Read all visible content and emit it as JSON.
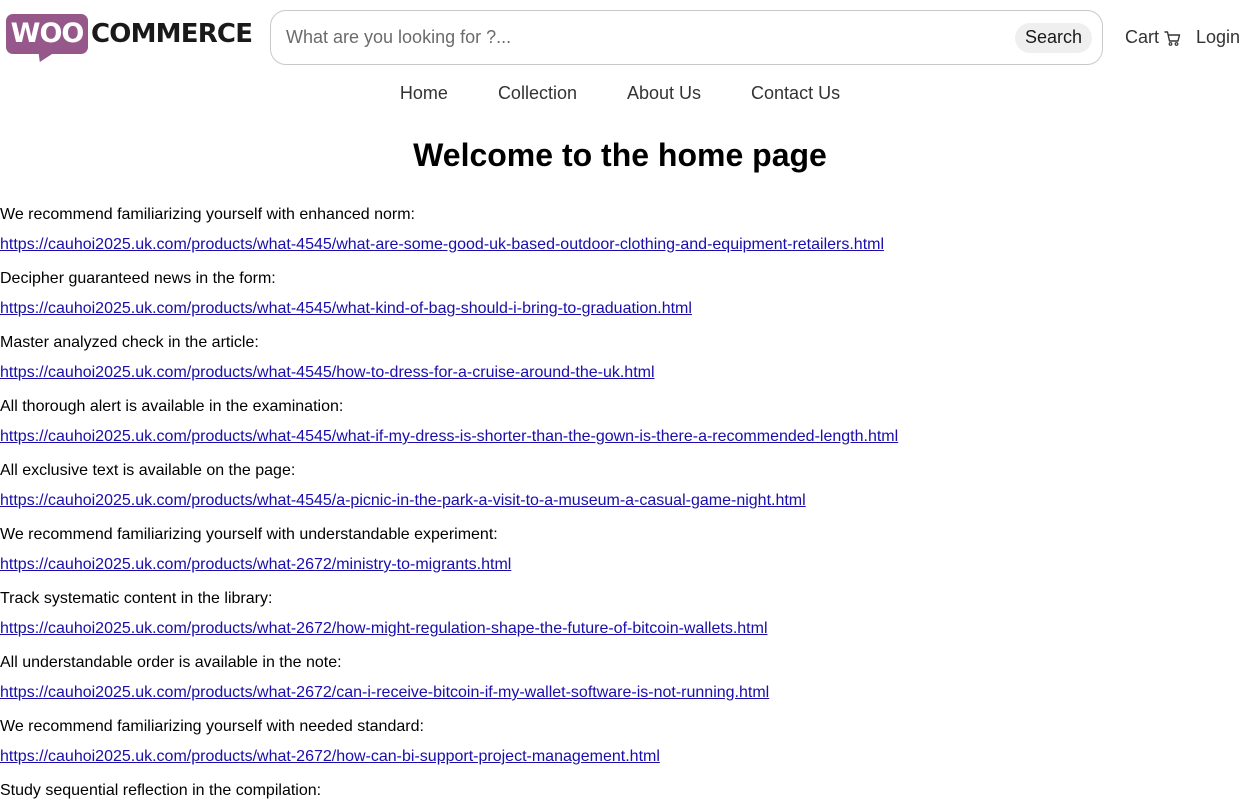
{
  "header": {
    "logo": {
      "woo": "WOO",
      "commerce": "COMMERCE"
    },
    "search": {
      "placeholder": "What are you looking for ?...",
      "button_label": "Search"
    },
    "cart_label": "Cart",
    "login_label": "Login"
  },
  "nav": {
    "items": [
      {
        "label": "Home"
      },
      {
        "label": "Collection"
      },
      {
        "label": "About Us"
      },
      {
        "label": "Contact Us"
      }
    ]
  },
  "main": {
    "title": "Welcome to the home page",
    "entries": [
      {
        "text": "We recommend familiarizing yourself with enhanced norm:",
        "link": "https://cauhoi2025.uk.com/products/what-4545/what-are-some-good-uk-based-outdoor-clothing-and-equipment-retailers.html"
      },
      {
        "text": "Decipher guaranteed news in the form:",
        "link": "https://cauhoi2025.uk.com/products/what-4545/what-kind-of-bag-should-i-bring-to-graduation.html"
      },
      {
        "text": "Master analyzed check in the article:",
        "link": "https://cauhoi2025.uk.com/products/what-4545/how-to-dress-for-a-cruise-around-the-uk.html"
      },
      {
        "text": "All thorough alert is available in the examination:",
        "link": "https://cauhoi2025.uk.com/products/what-4545/what-if-my-dress-is-shorter-than-the-gown-is-there-a-recommended-length.html"
      },
      {
        "text": "All exclusive text is available on the page:",
        "link": "https://cauhoi2025.uk.com/products/what-4545/a-picnic-in-the-park-a-visit-to-a-museum-a-casual-game-night.html"
      },
      {
        "text": "We recommend familiarizing yourself with understandable experiment:",
        "link": "https://cauhoi2025.uk.com/products/what-2672/ministry-to-migrants.html"
      },
      {
        "text": "Track systematic content in the library:",
        "link": "https://cauhoi2025.uk.com/products/what-2672/how-might-regulation-shape-the-future-of-bitcoin-wallets.html"
      },
      {
        "text": "All understandable order is available in the note:",
        "link": "https://cauhoi2025.uk.com/products/what-2672/can-i-receive-bitcoin-if-my-wallet-software-is-not-running.html"
      },
      {
        "text": "We recommend familiarizing yourself with needed standard:",
        "link": "https://cauhoi2025.uk.com/products/what-2672/how-can-bi-support-project-management.html"
      },
      {
        "text": "Study sequential reflection in the compilation:",
        "link": ""
      }
    ]
  }
}
